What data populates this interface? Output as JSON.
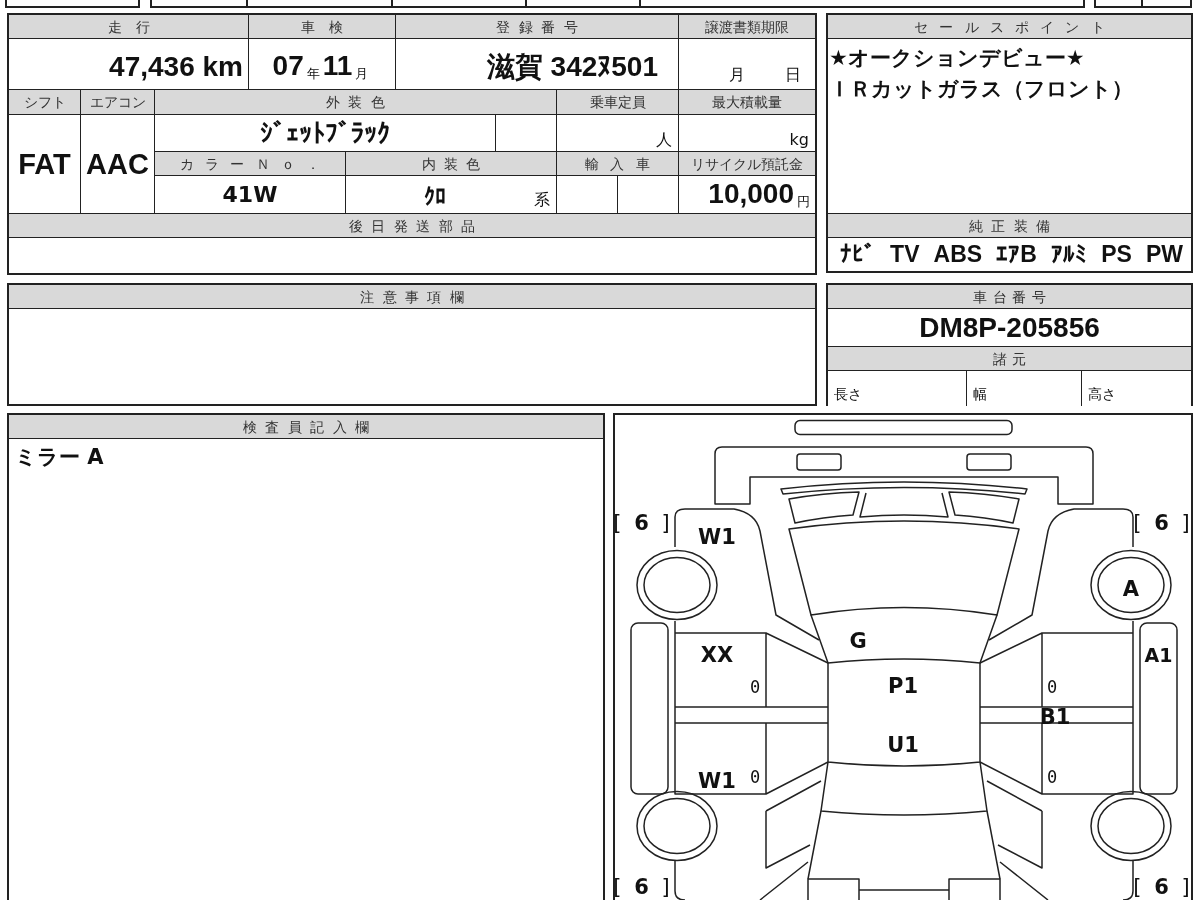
{
  "vehicle_table": {
    "mileage": {
      "label": "走行",
      "value": "47,436 km"
    },
    "inspection": {
      "label": "車検",
      "year": "07",
      "year_unit": "年",
      "month": "11",
      "month_unit": "月"
    },
    "registration": {
      "label": "登録番号",
      "value": "滋賀 342ﾇ501"
    },
    "transfer_deadline": {
      "label": "譲渡書類期限",
      "month_unit": "月",
      "day_unit": "日"
    },
    "shift": {
      "label": "シフト",
      "value": "FAT"
    },
    "air_conditioner": {
      "label": "エアコン",
      "value": "AAC"
    },
    "exterior_color": {
      "label": "外装色",
      "value": "ｼﾞｪｯﾄﾌﾞﾗｯｸ"
    },
    "seating_capacity": {
      "label": "乗車定員",
      "unit": "人"
    },
    "max_load": {
      "label": "最大積載量",
      "unit": "kg"
    },
    "color_number": {
      "label": "カラーＮｏ．",
      "value": "41W"
    },
    "interior_color": {
      "label": "内装色",
      "value": "ｸﾛ",
      "suffix": "系"
    },
    "imported": {
      "label": "輸入車"
    },
    "recycling_deposit": {
      "label": "リサイクル預託金",
      "amount": "10,000",
      "unit": "円"
    },
    "parts_to_follow": {
      "label": "後日発送部品"
    }
  },
  "sales_points": {
    "label": "セールスポイント",
    "lines": [
      "★オークションデビュー★",
      "ＩＲカットガラス（フロント）"
    ]
  },
  "equipment": {
    "label": "純正装備",
    "items": [
      "ﾅﾋﾞ",
      "TV",
      "ABS",
      "ｴｱB",
      "ｱﾙﾐ",
      "PS",
      "PW"
    ]
  },
  "notes": {
    "label": "注意事項欄"
  },
  "chassis": {
    "label": "車台番号",
    "value": "DM8P-205856"
  },
  "specs": {
    "label": "諸元",
    "fields": [
      "長さ",
      "幅",
      "高さ"
    ]
  },
  "inspector_notes": {
    "label": "検査員記入欄",
    "lines": [
      "ミラー A"
    ]
  },
  "damage_diagram": {
    "tread_marks": {
      "front_left": "[ **6** ]",
      "front_right": "[ **6** ]",
      "rear_left": "[ **6** ]",
      "rear_right": "[ **6** ]"
    },
    "damage_codes": {
      "left_front_fender": "W1",
      "right_front_wheel": "A",
      "left_front_door": "XX",
      "windshield": "G",
      "right_sill": "A1",
      "roof_front": "P1",
      "right_pillar": "B1",
      "roof_rear": "U1",
      "left_rear_door": "W1"
    },
    "door_marks": {
      "left_front_door": "0",
      "right_front_door": "0",
      "left_rear_door": "0",
      "right_rear_door": "0"
    }
  }
}
